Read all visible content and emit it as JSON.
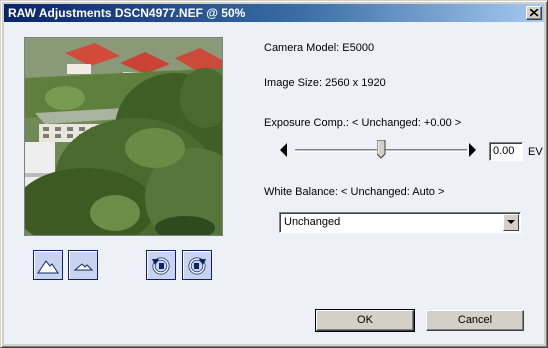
{
  "window": {
    "title": "RAW Adjustments DSCN4977.NEF @ 50%"
  },
  "info": {
    "camera_model": "Camera Model: E5000",
    "image_size": "Image Size: 2560 x 1920"
  },
  "exposure": {
    "label": "Exposure Comp.: < Unchanged: +0.00 >",
    "value": "0.00",
    "unit": "EV",
    "slider_fraction": 0.5
  },
  "white_balance": {
    "label": "White Balance: < Unchanged: Auto >",
    "selected": "Unchanged"
  },
  "buttons": {
    "ok": "OK",
    "cancel": "Cancel"
  },
  "tools": [
    "mountain-large-icon",
    "mountain-small-icon",
    "rotate-left-icon",
    "rotate-right-icon"
  ],
  "colors": {
    "title_start": "#0a246a",
    "title_end": "#a6caf0",
    "dialog_bg": "#eef0f7",
    "tool_bg": "#c9d2ee"
  }
}
